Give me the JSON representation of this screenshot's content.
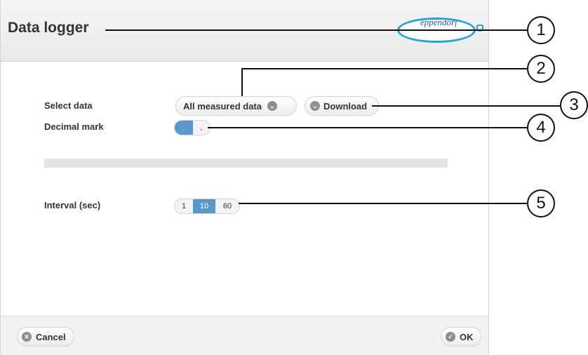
{
  "window": {
    "title": "Data logger",
    "logo_text": "eppendorf"
  },
  "fields": {
    "select_data_label": "Select data",
    "select_data_value": "All measured data",
    "download_label": "Download",
    "decimal_mark_label": "Decimal mark",
    "decimal_options": [
      ".",
      ","
    ],
    "decimal_selected": ".",
    "interval_label": "Interval (sec)",
    "interval_options": [
      "1",
      "10",
      "60"
    ],
    "interval_selected": "10"
  },
  "footer": {
    "cancel_label": "Cancel",
    "ok_label": "OK"
  },
  "callouts": [
    "1",
    "2",
    "3",
    "4",
    "5"
  ],
  "colors": {
    "accent": "#5a98cb",
    "logo": "#27a0db",
    "icon_grey": "#8e8e8e"
  }
}
